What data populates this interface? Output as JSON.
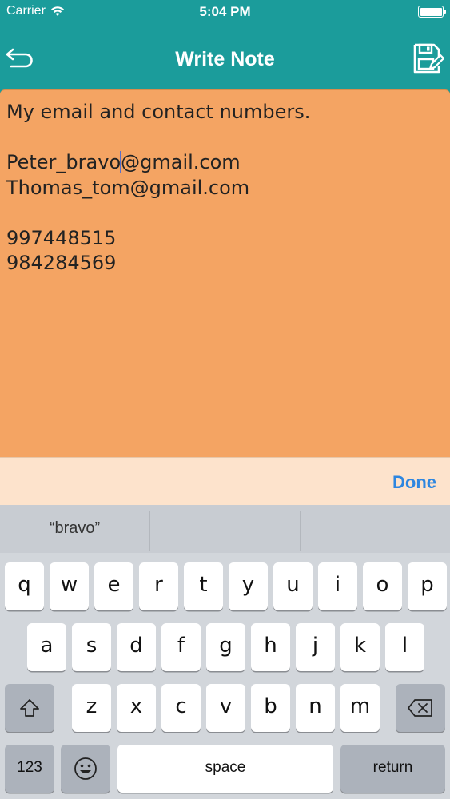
{
  "status_bar": {
    "carrier": "Carrier",
    "time": "5:04 PM",
    "battery_level": 1.0
  },
  "nav": {
    "title": "Write Note",
    "back_icon": "back-arrow-icon",
    "save_icon": "save-note-icon"
  },
  "note": {
    "text_before_cursor": "My email and contact numbers.\n\nPeter_bravo",
    "text_after_cursor": "@gmail.com\nThomas_tom@gmail.com\n\n997448515\n984284569"
  },
  "accessory": {
    "done_label": "Done"
  },
  "keyboard": {
    "suggestions": [
      "“bravo”",
      "",
      ""
    ],
    "row1": [
      "q",
      "w",
      "e",
      "r",
      "t",
      "y",
      "u",
      "i",
      "o",
      "p"
    ],
    "row2": [
      "a",
      "s",
      "d",
      "f",
      "g",
      "h",
      "j",
      "k",
      "l"
    ],
    "row3": [
      "z",
      "x",
      "c",
      "v",
      "b",
      "n",
      "m"
    ],
    "numbers_label": "123",
    "space_label": "space",
    "return_label": "return",
    "shift_icon": "shift-icon",
    "delete_icon": "delete-icon",
    "emoji_icon": "emoji-icon"
  },
  "colors": {
    "nav_bg": "#1b9c9b",
    "note_bg": "#f4a463",
    "accessory_bg": "#fde3cc",
    "done_text": "#2d86e0"
  }
}
